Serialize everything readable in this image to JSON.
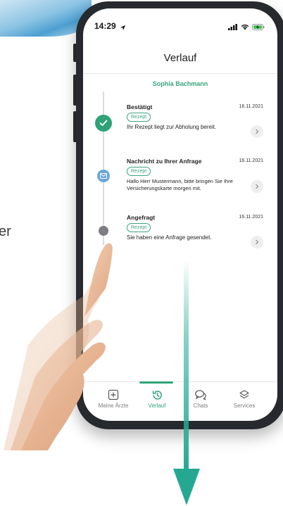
{
  "status_bar": {
    "time": "14:29"
  },
  "header": {
    "title": "Verlauf"
  },
  "patient": {
    "name": "Sophia Bachmann"
  },
  "entries": [
    {
      "title": "Bestätigt",
      "date": "16.11.2021",
      "badge": "Rezept",
      "text": "Ihr Rezept liegt zur Abholung bereit.",
      "icon": "check-icon"
    },
    {
      "title": "Nachricht zu Ihrer Anfrage",
      "date": "16.11.2021",
      "badge": "Rezept",
      "text": "Hallo Herr Mustermann, bitte bringen Sie Ihre Versicherungskarte morgen mit.",
      "icon": "mail-icon"
    },
    {
      "title": "Angefragt",
      "date": "16.11.2021",
      "badge": "Rezept",
      "text": "Sie haben eine Anfrage gesendet.",
      "icon": "dot-icon"
    }
  ],
  "tabs": [
    {
      "label": "Meine Ärzte",
      "icon": "plus-square-icon",
      "active": false
    },
    {
      "label": "Verlauf",
      "icon": "history-icon",
      "active": true
    },
    {
      "label": "Chats",
      "icon": "chat-bubbles-icon",
      "active": false
    },
    {
      "label": "Services",
      "icon": "layers-icon",
      "active": false
    }
  ],
  "background_text": "er",
  "colors": {
    "accent": "#2fa277",
    "accent_text": "#3ba47e",
    "mail_dot": "#6aa6d8",
    "arrow": "#25a892"
  }
}
